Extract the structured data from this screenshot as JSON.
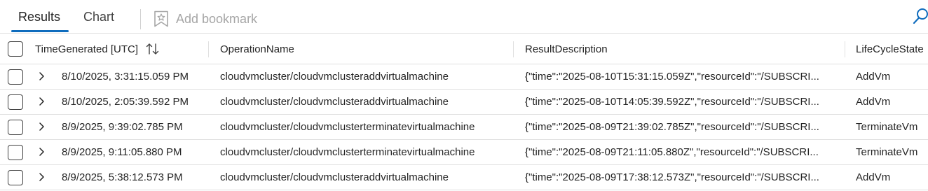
{
  "tabs": {
    "results": "Results",
    "chart": "Chart",
    "add_bookmark": "Add bookmark"
  },
  "icons": {
    "bookmark": "bookmark-icon",
    "search": "search-icon",
    "sort": "sort-arrows-icon",
    "expand": "chevron-right-icon"
  },
  "colors": {
    "accent": "#0f6cbd",
    "disabled_text": "#a6a6a6",
    "border": "#e0e0e0"
  },
  "table": {
    "columns": {
      "time": "TimeGenerated [UTC]",
      "operation": "OperationName",
      "description": "ResultDescription",
      "lifecycle": "LifeCycleState"
    },
    "rows": [
      {
        "time": "8/10/2025, 3:31:15.059 PM",
        "operation": "cloudvmcluster/cloudvmclusteraddvirtualmachine",
        "description": "{\"time\":\"2025-08-10T15:31:15.059Z\",\"resourceId\":\"/SUBSCRI...",
        "lifecycle": "AddVm"
      },
      {
        "time": "8/10/2025, 2:05:39.592 PM",
        "operation": "cloudvmcluster/cloudvmclusteraddvirtualmachine",
        "description": "{\"time\":\"2025-08-10T14:05:39.592Z\",\"resourceId\":\"/SUBSCRI...",
        "lifecycle": "AddVm"
      },
      {
        "time": "8/9/2025, 9:39:02.785 PM",
        "operation": "cloudvmcluster/cloudvmclusterterminatevirtualmachine",
        "description": "{\"time\":\"2025-08-09T21:39:02.785Z\",\"resourceId\":\"/SUBSCRI...",
        "lifecycle": "TerminateVm"
      },
      {
        "time": "8/9/2025, 9:11:05.880 PM",
        "operation": "cloudvmcluster/cloudvmclusterterminatevirtualmachine",
        "description": "{\"time\":\"2025-08-09T21:11:05.880Z\",\"resourceId\":\"/SUBSCRI...",
        "lifecycle": "TerminateVm"
      },
      {
        "time": "8/9/2025, 5:38:12.573 PM",
        "operation": "cloudvmcluster/cloudvmclusteraddvirtualmachine",
        "description": "{\"time\":\"2025-08-09T17:38:12.573Z\",\"resourceId\":\"/SUBSCRI...",
        "lifecycle": "AddVm"
      }
    ]
  }
}
